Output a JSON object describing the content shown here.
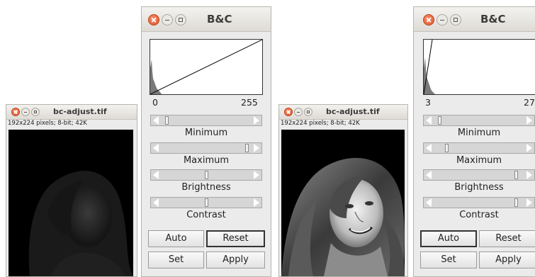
{
  "image_windows": [
    {
      "title": "bc-adjust.tif",
      "info": "192x224 pixels; 8-bit; 42K",
      "state": "original"
    },
    {
      "title": "bc-adjust.tif",
      "info": "192x224 pixels; 8-bit; 42K",
      "state": "adjusted"
    }
  ],
  "bc_panels": [
    {
      "title": "B&C",
      "range_min": "0",
      "range_max": "255",
      "sliders": [
        {
          "label": "Minimum",
          "position": 0.02
        },
        {
          "label": "Maximum",
          "position": 0.97
        },
        {
          "label": "Brightness",
          "position": 0.5
        },
        {
          "label": "Contrast",
          "position": 0.5
        }
      ],
      "buttons": {
        "auto": "Auto",
        "reset": "Reset",
        "set": "Set",
        "apply": "Apply"
      },
      "focused_button": "reset"
    },
    {
      "title": "B&C",
      "range_min": "3",
      "range_max": "27",
      "sliders": [
        {
          "label": "Minimum",
          "position": 0.02
        },
        {
          "label": "Maximum",
          "position": 0.1
        },
        {
          "label": "Brightness",
          "position": 0.97
        },
        {
          "label": "Contrast",
          "position": 0.97
        }
      ],
      "buttons": {
        "auto": "Auto",
        "reset": "Reset",
        "set": "Set",
        "apply": "Apply"
      },
      "focused_button": "auto"
    }
  ],
  "colors": {
    "close_button": "#e2542c",
    "window_bg": "#ebebeb",
    "image_bg": "#000000"
  },
  "icons": [
    "close-icon",
    "minimize-icon",
    "maximize-icon",
    "arrow-left-icon",
    "arrow-right-icon"
  ]
}
